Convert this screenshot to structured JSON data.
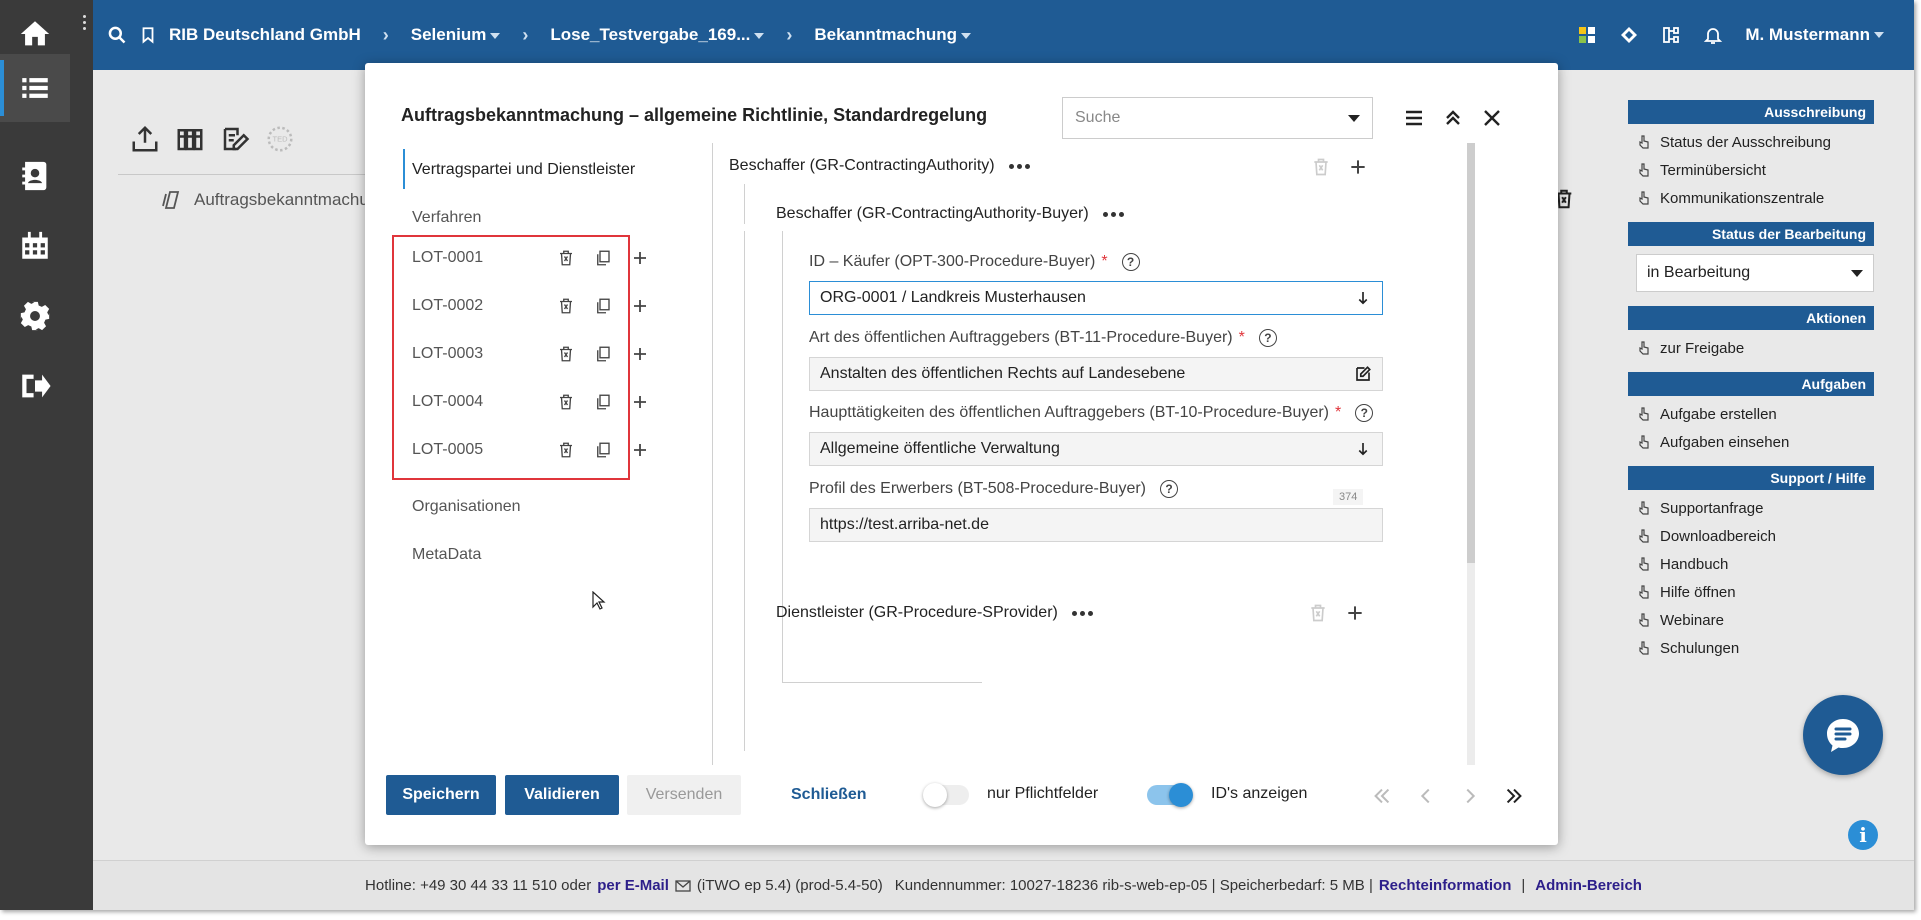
{
  "topbar": {
    "breadcrumbs": [
      {
        "label": "RIB Deutschland GmbH",
        "dropdown": false
      },
      {
        "label": "Selenium",
        "dropdown": true
      },
      {
        "label": "Lose_Testvergabe_169...",
        "dropdown": true
      },
      {
        "label": "Bekanntmachung",
        "dropdown": true
      }
    ],
    "user": "M. Mustermann"
  },
  "background": {
    "doc_label": "Auftragsbekanntmachu"
  },
  "rightpanel": {
    "ausschreibung": {
      "title": "Ausschreibung",
      "items": [
        "Status der Ausschreibung",
        "Terminübersicht",
        "Kommunikationszentrale"
      ]
    },
    "status": {
      "title": "Status der Bearbeitung",
      "value": "in Bearbeitung"
    },
    "aktionen": {
      "title": "Aktionen",
      "items": [
        "zur Freigabe"
      ]
    },
    "aufgaben": {
      "title": "Aufgaben",
      "items": [
        "Aufgabe erstellen",
        "Aufgaben einsehen"
      ]
    },
    "support": {
      "title": "Support / Hilfe",
      "items": [
        "Supportanfrage",
        "Downloadbereich",
        "Handbuch",
        "Hilfe öffnen",
        "Webinare",
        "Schulungen"
      ]
    }
  },
  "footer": {
    "hotline": "Hotline: +49 30 44 33 11 510 oder",
    "email_link": "per E-Mail",
    "version": "(iTWO ep 5.4) (prod-5.4-50)",
    "customer": "Kundennummer: 10027-18236 rib-s-web-ep-05 | Speicherbedarf: 5 MB |",
    "legal_link": "Rechteinformation",
    "sep": "|",
    "admin_link": "Admin-Bereich"
  },
  "modal": {
    "title": "Auftragsbekanntmachung – allgemeine Richtlinie, Standardregelung",
    "search_placeholder": "Suche",
    "nav": {
      "vertragspartei": "Vertragspartei und Dienstleister",
      "verfahren": "Verfahren",
      "lots": [
        "LOT-0001",
        "LOT-0002",
        "LOT-0003",
        "LOT-0004",
        "LOT-0005"
      ],
      "organisationen": "Organisationen",
      "metadata": "MetaData"
    },
    "content": {
      "section1": "Beschaffer (GR-ContractingAuthority)",
      "section1_sub": "Beschaffer (GR-ContractingAuthority-Buyer)",
      "fields": [
        {
          "label": "ID – Käufer (OPT-300-Procedure-Buyer)",
          "required": "*",
          "value": "ORG-0001 / Landkreis Musterhausen"
        },
        {
          "label": "Art des öffentlichen Auftraggebers (BT-11-Procedure-Buyer)",
          "required": "*",
          "value": "Anstalten des öffentlichen Rechts auf Landesebene"
        },
        {
          "label": "Haupttätigkeiten des öffentlichen Auftraggebers (BT-10-Procedure-Buyer)",
          "required": "*",
          "value": "Allgemeine öffentliche Verwaltung"
        },
        {
          "label": "Profil des Erwerbers (BT-508-Procedure-Buyer)",
          "required": "",
          "value": "https://test.arriba-net.de",
          "char_count": "374"
        }
      ],
      "section2": "Dienstleister (GR-Procedure-SProvider)"
    },
    "footer": {
      "save": "Speichern",
      "validate": "Validieren",
      "send": "Versenden",
      "close": "Schließen",
      "toggle_required": {
        "label": "nur Pflichtfelder",
        "on": false
      },
      "toggle_ids": {
        "label": "ID's anzeigen",
        "on": true
      }
    }
  },
  "colors": {
    "brand": "#1f5b94",
    "accent": "#2b8ed6",
    "highlight": "#e0353b",
    "rail": "#3a3a3a"
  }
}
